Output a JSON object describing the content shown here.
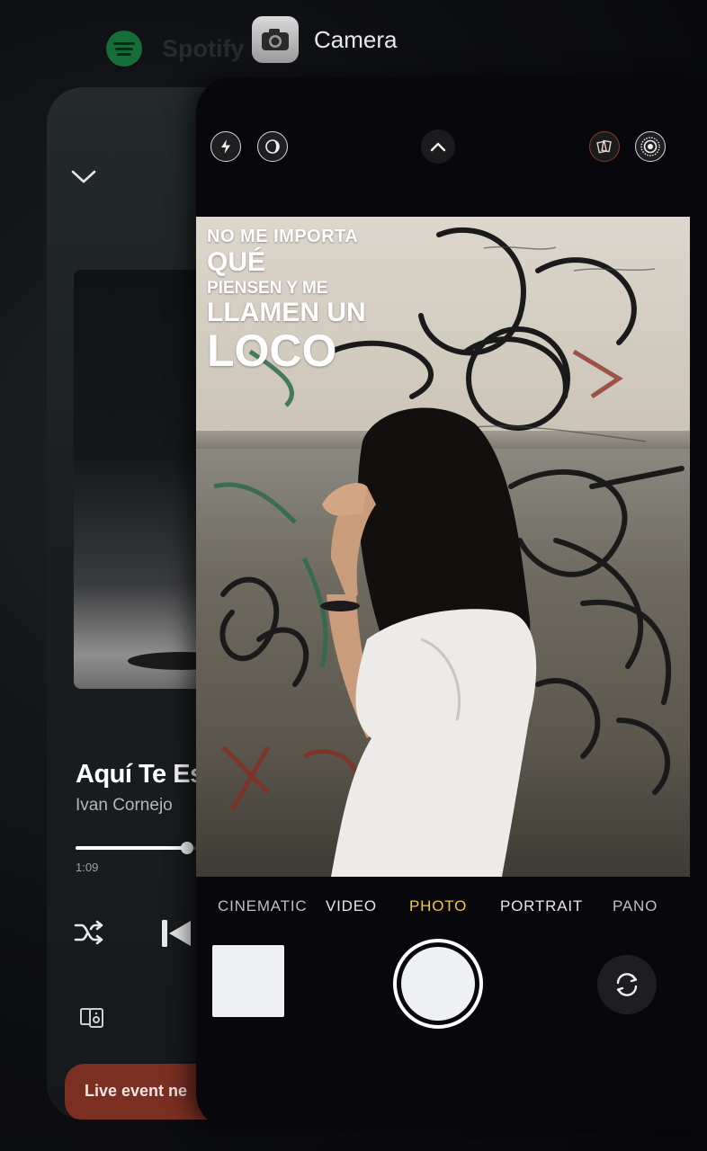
{
  "app_switcher": {
    "spotify_label": "Spotify",
    "camera_label": "Camera"
  },
  "spotify": {
    "song_title": "Aquí Te Es",
    "artist": "Ivan Cornejo",
    "elapsed": "1:09",
    "progress": 0.31,
    "live_banner": "Live event ne",
    "accent": "#1db954",
    "banner_color": "#7a2f22"
  },
  "camera": {
    "overlay_text": {
      "line1": "NO ME IMPORTA",
      "line2": "QUÉ",
      "line3": "PIENSEN Y ME",
      "line4": "LLAMEN UN",
      "line5": "LOCO"
    },
    "modes": [
      "CINEMATIC",
      "VIDEO",
      "PHOTO",
      "PORTRAIT",
      "PANO"
    ],
    "selected_mode": "PHOTO",
    "selected_color": "#f3c842",
    "top_icons": [
      "flash-icon",
      "night-mode-icon",
      "chevron-up-icon",
      "photographic-styles-icon",
      "live-photo-icon"
    ]
  }
}
